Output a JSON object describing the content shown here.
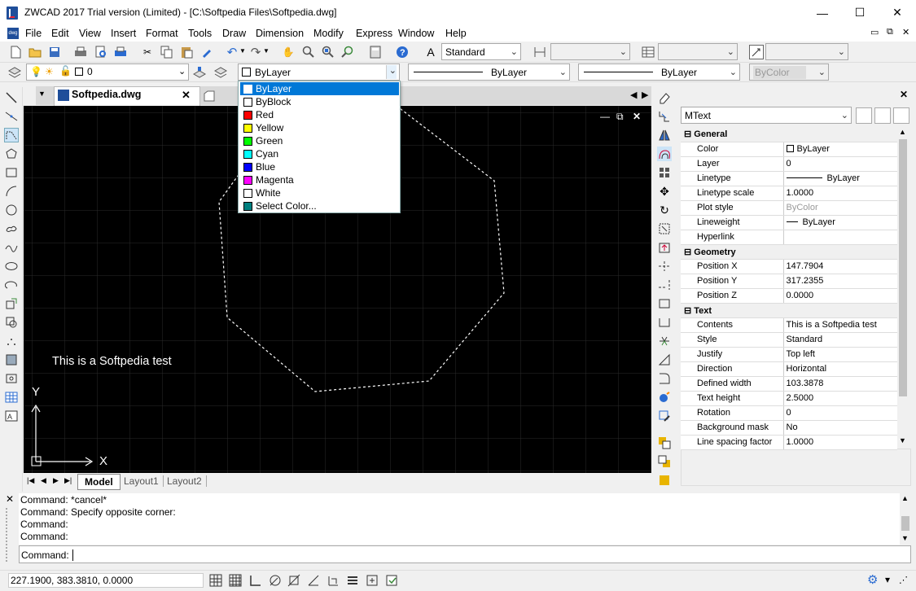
{
  "window": {
    "title": "ZWCAD 2017 Trial version (Limited) - [C:\\Softpedia Files\\Softpedia.dwg]",
    "minimize": "—",
    "maximize": "☐",
    "close": "✕"
  },
  "menu": [
    "File",
    "Edit",
    "View",
    "Insert",
    "Format",
    "Tools",
    "Draw",
    "Dimension",
    "Modify",
    "Express",
    "Window",
    "Help"
  ],
  "toolbar": {
    "textstyle": "Standard",
    "layer_value": "0",
    "color_value": "ByLayer",
    "linetype_value": "ByLayer",
    "lineweight_value": "ByLayer",
    "plotstyle_value": "ByColor"
  },
  "doc_tab": {
    "label": "Softpedia.dwg",
    "close": "✕"
  },
  "canvas": {
    "text": "This is a Softpedia test",
    "axis_y": "Y",
    "axis_x": "X"
  },
  "layout_tabs": [
    "Model",
    "Layout1",
    "Layout2"
  ],
  "color_dropdown": {
    "items": [
      {
        "label": "ByLayer",
        "color": "#ffffff"
      },
      {
        "label": "ByBlock",
        "color": "#ffffff"
      },
      {
        "label": "Red",
        "color": "#ff0000"
      },
      {
        "label": "Yellow",
        "color": "#ffff00"
      },
      {
        "label": "Green",
        "color": "#00ff00"
      },
      {
        "label": "Cyan",
        "color": "#00ffff"
      },
      {
        "label": "Blue",
        "color": "#0000ff"
      },
      {
        "label": "Magenta",
        "color": "#ff00ff"
      },
      {
        "label": "White",
        "color": "#ffffff"
      },
      {
        "label": "Select Color...",
        "color": "#008080"
      }
    ],
    "selected": "ByLayer"
  },
  "properties": {
    "object_type": "MText",
    "sections": [
      {
        "name": "General",
        "rows": [
          [
            "Color",
            "ByLayer"
          ],
          [
            "Layer",
            "0"
          ],
          [
            "Linetype",
            "ByLayer"
          ],
          [
            "Linetype scale",
            "1.0000"
          ],
          [
            "Plot style",
            "ByColor"
          ],
          [
            "Lineweight",
            "ByLayer"
          ],
          [
            "Hyperlink",
            ""
          ]
        ]
      },
      {
        "name": "Geometry",
        "rows": [
          [
            "Position X",
            "147.7904"
          ],
          [
            "Position Y",
            "317.2355"
          ],
          [
            "Position Z",
            "0.0000"
          ]
        ]
      },
      {
        "name": "Text",
        "rows": [
          [
            "Contents",
            "This is a Softpedia test"
          ],
          [
            "Style",
            "Standard"
          ],
          [
            "Justify",
            "Top left"
          ],
          [
            "Direction",
            "Horizontal"
          ],
          [
            "Defined width",
            "103.3878"
          ],
          [
            "Text height",
            "2.5000"
          ],
          [
            "Rotation",
            "0"
          ],
          [
            "Background mask",
            "No"
          ],
          [
            "Line spacing factor",
            "1.0000"
          ]
        ]
      }
    ]
  },
  "command": {
    "history": [
      "Command: *cancel*",
      "Command: Specify opposite corner:",
      "Command:",
      "Command:"
    ],
    "prompt": "Command:"
  },
  "status": {
    "coords": "227.1900, 383.3810, 0.0000"
  }
}
